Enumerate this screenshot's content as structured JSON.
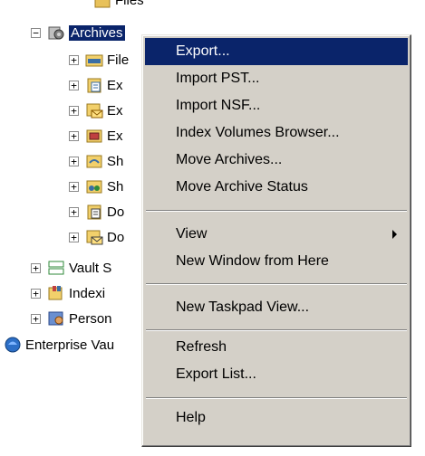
{
  "tree": {
    "top_partial": "Files",
    "items": [
      {
        "label": "Archives",
        "expander": "−",
        "icon": "archives-icon",
        "selected": true
      },
      {
        "label": "File",
        "expander": "+",
        "icon": "file-archive-icon"
      },
      {
        "label": "Ex",
        "expander": "+",
        "icon": "exchange-journal-icon"
      },
      {
        "label": "Ex",
        "expander": "+",
        "icon": "exchange-mailbox-icon"
      },
      {
        "label": "Ex",
        "expander": "+",
        "icon": "exchange-public-folder-icon"
      },
      {
        "label": "Sh",
        "expander": "+",
        "icon": "sharepoint-icon"
      },
      {
        "label": "Sh",
        "expander": "+",
        "icon": "shared-icon"
      },
      {
        "label": "Do",
        "expander": "+",
        "icon": "domino-journal-icon"
      },
      {
        "label": "Do",
        "expander": "+",
        "icon": "domino-mailbox-icon"
      },
      {
        "label": "Vault S",
        "expander": "+",
        "icon": "vault-store-icon"
      },
      {
        "label": "Indexi",
        "expander": "+",
        "icon": "indexing-icon"
      },
      {
        "label": "Person",
        "expander": "+",
        "icon": "personal-store-icon"
      },
      {
        "label": "Enterprise Vau",
        "expander": "",
        "icon": "enterprise-vault-icon"
      }
    ]
  },
  "context_menu": {
    "items": [
      {
        "label": "Export...",
        "highlighted": true
      },
      {
        "label": "Import PST..."
      },
      {
        "label": "Import NSF..."
      },
      {
        "label": "Index Volumes Browser..."
      },
      {
        "label": "Move Archives..."
      },
      {
        "label": "Move Archive Status"
      },
      {
        "label": "View",
        "submenu": true
      },
      {
        "label": "New Window from Here"
      },
      {
        "label": "New Taskpad View..."
      },
      {
        "label": "Refresh"
      },
      {
        "label": "Export List..."
      },
      {
        "label": "Help"
      }
    ]
  },
  "colors": {
    "selection": "#0a246a",
    "menu_bg": "#d4d0c8"
  }
}
